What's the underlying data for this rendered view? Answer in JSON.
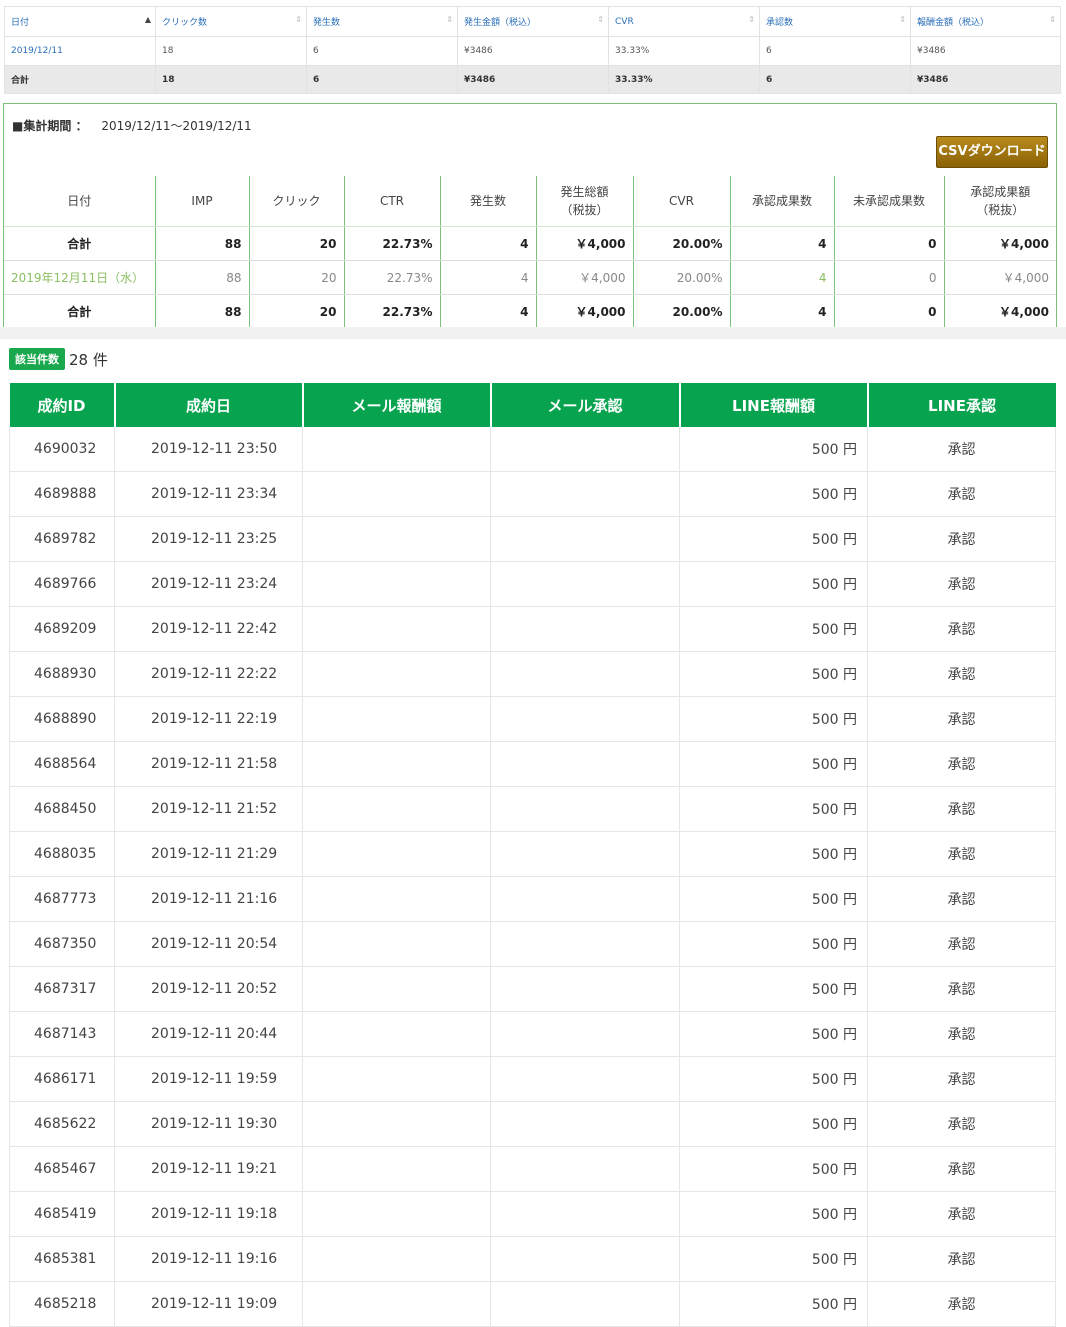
{
  "summary_top": {
    "headers": [
      "日付",
      "クリック数",
      "発生数",
      "発生金額（税込）",
      "CVR",
      "承認数",
      "報酬金額（税込）"
    ],
    "row": [
      "2019/12/11",
      "18",
      "6",
      "¥3486",
      "33.33%",
      "6",
      "¥3486"
    ],
    "total": [
      "合計",
      "18",
      "6",
      "¥3486",
      "33.33%",
      "6",
      "¥3486"
    ]
  },
  "report": {
    "period_label": "■集計期間 ：",
    "period_value": "2019/12/11～2019/12/11",
    "csv_button": "CSVダウンロード",
    "headers": [
      "日付",
      "IMP",
      "クリック",
      "CTR",
      "発生数",
      "発生総額\n（税抜）",
      "CVR",
      "承認成果数",
      "未承認成果数",
      "承認成果額\n（税抜）"
    ],
    "total_row": [
      "合計",
      "88",
      "20",
      "22.73%",
      "4",
      "￥4,000",
      "20.00%",
      "4",
      "0",
      "￥4,000"
    ],
    "daily_row": [
      "2019年12月11日（水）",
      "88",
      "20",
      "22.73%",
      "4",
      "￥4,000",
      "20.00%",
      "4",
      "0",
      "￥4,000"
    ],
    "footer_row": [
      "合計",
      "88",
      "20",
      "22.73%",
      "4",
      "￥4,000",
      "20.00%",
      "4",
      "0",
      "￥4,000"
    ]
  },
  "results": {
    "badge": "該当件数",
    "count": "28 件",
    "headers": [
      "成約ID",
      "成約日",
      "メール報酬額",
      "メール承認",
      "LINE報酬額",
      "LINE承認"
    ],
    "rows": [
      [
        "4690032",
        "2019-12-11 23:50",
        "",
        "",
        "500 円",
        "承認"
      ],
      [
        "4689888",
        "2019-12-11 23:34",
        "",
        "",
        "500 円",
        "承認"
      ],
      [
        "4689782",
        "2019-12-11 23:25",
        "",
        "",
        "500 円",
        "承認"
      ],
      [
        "4689766",
        "2019-12-11 23:24",
        "",
        "",
        "500 円",
        "承認"
      ],
      [
        "4689209",
        "2019-12-11 22:42",
        "",
        "",
        "500 円",
        "承認"
      ],
      [
        "4688930",
        "2019-12-11 22:22",
        "",
        "",
        "500 円",
        "承認"
      ],
      [
        "4688890",
        "2019-12-11 22:19",
        "",
        "",
        "500 円",
        "承認"
      ],
      [
        "4688564",
        "2019-12-11 21:58",
        "",
        "",
        "500 円",
        "承認"
      ],
      [
        "4688450",
        "2019-12-11 21:52",
        "",
        "",
        "500 円",
        "承認"
      ],
      [
        "4688035",
        "2019-12-11 21:29",
        "",
        "",
        "500 円",
        "承認"
      ],
      [
        "4687773",
        "2019-12-11 21:16",
        "",
        "",
        "500 円",
        "承認"
      ],
      [
        "4687350",
        "2019-12-11 20:54",
        "",
        "",
        "500 円",
        "承認"
      ],
      [
        "4687317",
        "2019-12-11 20:52",
        "",
        "",
        "500 円",
        "承認"
      ],
      [
        "4687143",
        "2019-12-11 20:44",
        "",
        "",
        "500 円",
        "承認"
      ],
      [
        "4686171",
        "2019-12-11 19:59",
        "",
        "",
        "500 円",
        "承認"
      ],
      [
        "4685622",
        "2019-12-11 19:30",
        "",
        "",
        "500 円",
        "承認"
      ],
      [
        "4685467",
        "2019-12-11 19:21",
        "",
        "",
        "500 円",
        "承認"
      ],
      [
        "4685419",
        "2019-12-11 19:18",
        "",
        "",
        "500 円",
        "承認"
      ],
      [
        "4685381",
        "2019-12-11 19:16",
        "",
        "",
        "500 円",
        "承認"
      ],
      [
        "4685218",
        "2019-12-11 19:09",
        "",
        "",
        "500 円",
        "承認"
      ]
    ]
  },
  "colors": {
    "link_blue": "#2a6fb8",
    "frame_green": "#7cc27a",
    "header_green": "#07a34f",
    "badge_green": "#1aa84e",
    "csv_gold": "#9a7210",
    "date_green": "#8bbf63"
  }
}
